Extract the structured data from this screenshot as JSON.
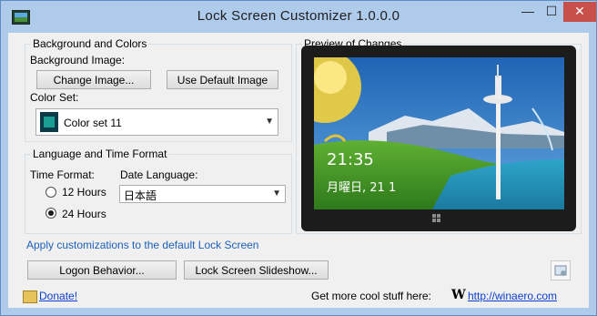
{
  "window": {
    "title": "Lock Screen Customizer 1.0.0.0",
    "minimize_glyph": "—",
    "maximize_glyph": "☐",
    "close_glyph": "✕",
    "icon": "app-icon"
  },
  "background_group": {
    "title": "Background and Colors",
    "background_image_label": "Background Image:",
    "change_image_button": "Change Image...",
    "use_default_button": "Use Default Image",
    "color_set_label": "Color Set:",
    "color_set_value": "Color set 11",
    "color_set_swatch": "#0a3b46"
  },
  "language_group": {
    "title": "Language and Time Format",
    "time_format_label": "Time Format:",
    "options": [
      {
        "label": "12 Hours",
        "selected": false
      },
      {
        "label": "24 Hours",
        "selected": true
      }
    ],
    "date_language_label": "Date Language:",
    "date_language_value": "日本語"
  },
  "preview": {
    "title": "Preview of Changes",
    "time": "21:35",
    "date": "月曜日, 21 1"
  },
  "apply_default_text": "Apply customizations to the default Lock Screen",
  "buttons": {
    "logon_behavior": "Logon Behavior...",
    "lock_screen_slideshow": "Lock Screen Slideshow..."
  },
  "footer": {
    "donate_label": "Donate!",
    "promo_text": "Get more cool stuff here:",
    "winaero_logo": "W",
    "winaero_link": "http://winaero.com"
  }
}
